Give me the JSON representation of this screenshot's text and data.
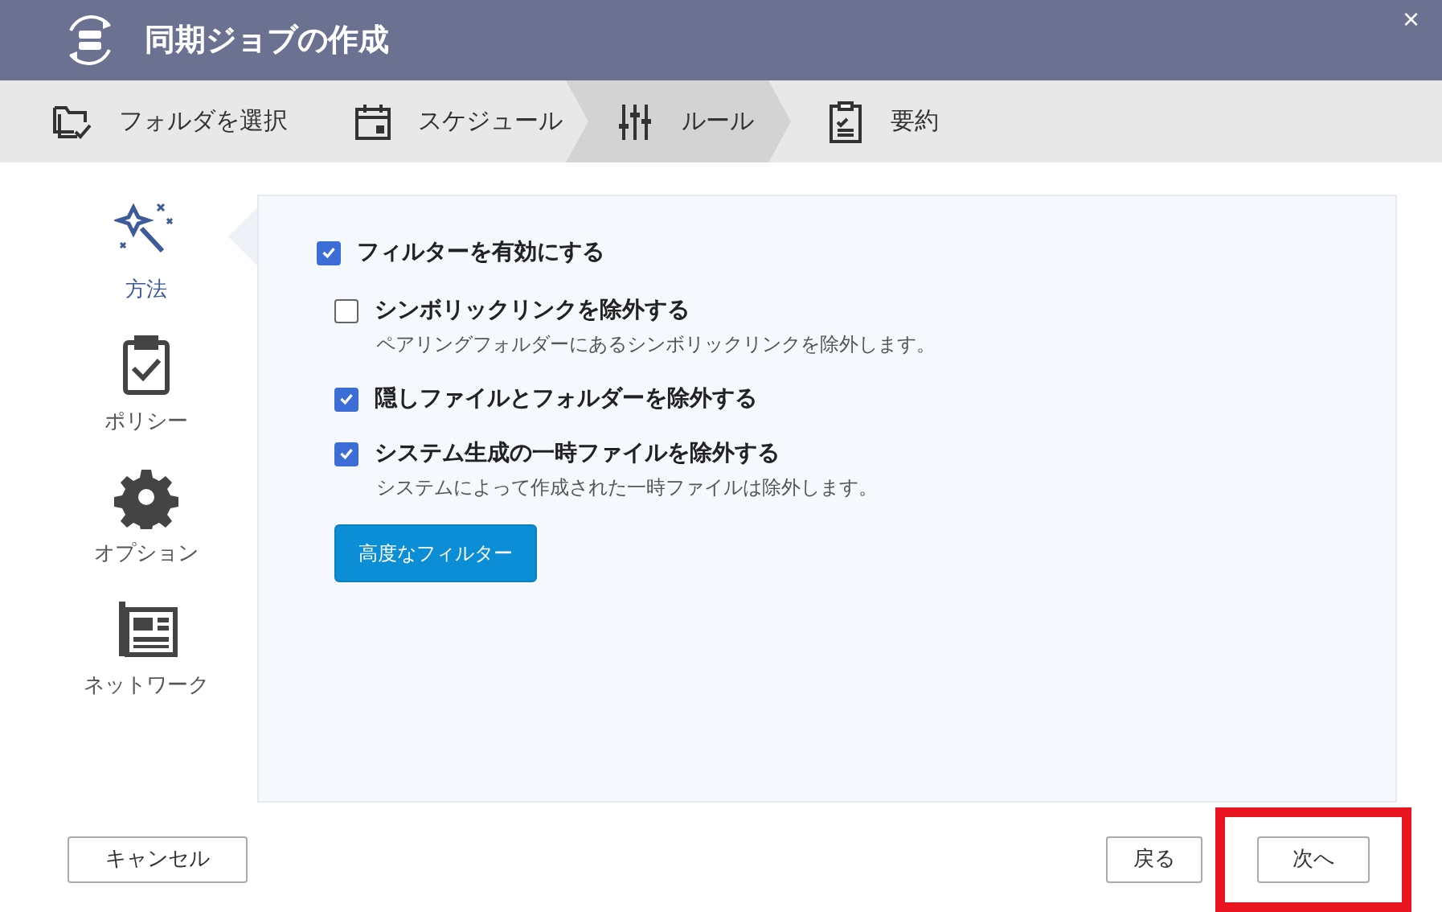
{
  "window": {
    "title": "同期ジョブの作成",
    "close": "×"
  },
  "steps": [
    {
      "label": "フォルダを選択",
      "kind": "folder",
      "selected": false
    },
    {
      "label": "スケジュール",
      "kind": "calendar",
      "selected": false
    },
    {
      "label": "ルール",
      "kind": "sliders",
      "selected": true
    },
    {
      "label": "要約",
      "kind": "summary",
      "selected": false
    }
  ],
  "sidebar": {
    "items": [
      {
        "label": "方法",
        "kind": "wand",
        "selected": true
      },
      {
        "label": "ポリシー",
        "kind": "clipboard",
        "selected": false
      },
      {
        "label": "オプション",
        "kind": "gear",
        "selected": false
      },
      {
        "label": "ネットワーク",
        "kind": "network",
        "selected": false
      }
    ]
  },
  "filter": {
    "label": "フィルターを有効にする",
    "checked": true
  },
  "options": [
    {
      "label": "シンボリックリンクを除外する",
      "checked": false,
      "description": "ペアリングフォルダーにあるシンボリックリンクを除外します。"
    },
    {
      "label": "隠しファイルとフォルダーを除外する",
      "checked": true
    },
    {
      "label": "システム生成の一時ファイルを除外する",
      "checked": true,
      "description": "システムによって作成された一時ファイルは除外します。"
    }
  ],
  "advanced_button": "高度なフィルター",
  "footer": {
    "cancel": "キャンセル",
    "back": "戻る",
    "next": {
      "label": "次へ",
      "highlighted": true
    }
  }
}
